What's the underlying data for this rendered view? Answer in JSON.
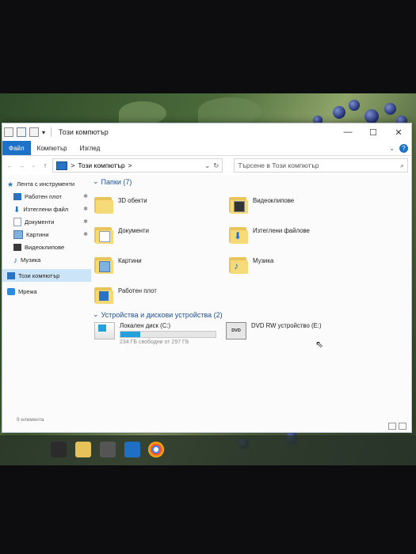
{
  "window": {
    "title": "Този компютър",
    "tabs": {
      "file": "Файл",
      "computer": "Компютър",
      "view": "Изглед"
    },
    "help": "?",
    "address": {
      "path": "Този компютър",
      "chevron": ">",
      "search_placeholder": "Търсене в Този компютър"
    }
  },
  "nav": {
    "quick_access": "Лента с инструменти",
    "items": [
      {
        "label": "Работен плот",
        "pinned": true
      },
      {
        "label": "Изтеглени файл",
        "pinned": true
      },
      {
        "label": "Документи",
        "pinned": true
      },
      {
        "label": "Картини",
        "pinned": true
      },
      {
        "label": "Видеоклипове",
        "pinned": false
      },
      {
        "label": "Музика",
        "pinned": false
      }
    ],
    "this_pc": "Този компютър",
    "network": "Мрежа"
  },
  "folders_group": "Папки (7)",
  "folders": [
    {
      "label": "3D обекти"
    },
    {
      "label": "Видеоклипове"
    },
    {
      "label": "Документи"
    },
    {
      "label": "Изтеглени файлове"
    },
    {
      "label": "Картини"
    },
    {
      "label": "Музика"
    },
    {
      "label": "Работен плот"
    }
  ],
  "devices_group": "Устройства и дискови устройства (2)",
  "drives": [
    {
      "label": "Локален диск (C:)",
      "space": "234 ГБ свободни от 297 ГБ",
      "used_fraction": 0.21
    },
    {
      "label": "DVD RW устройство (E:)",
      "badge": "DVD"
    }
  ],
  "status": "9 елемента",
  "colors": {
    "accent": "#1c72c6",
    "drive_bar": "#26a0da"
  }
}
